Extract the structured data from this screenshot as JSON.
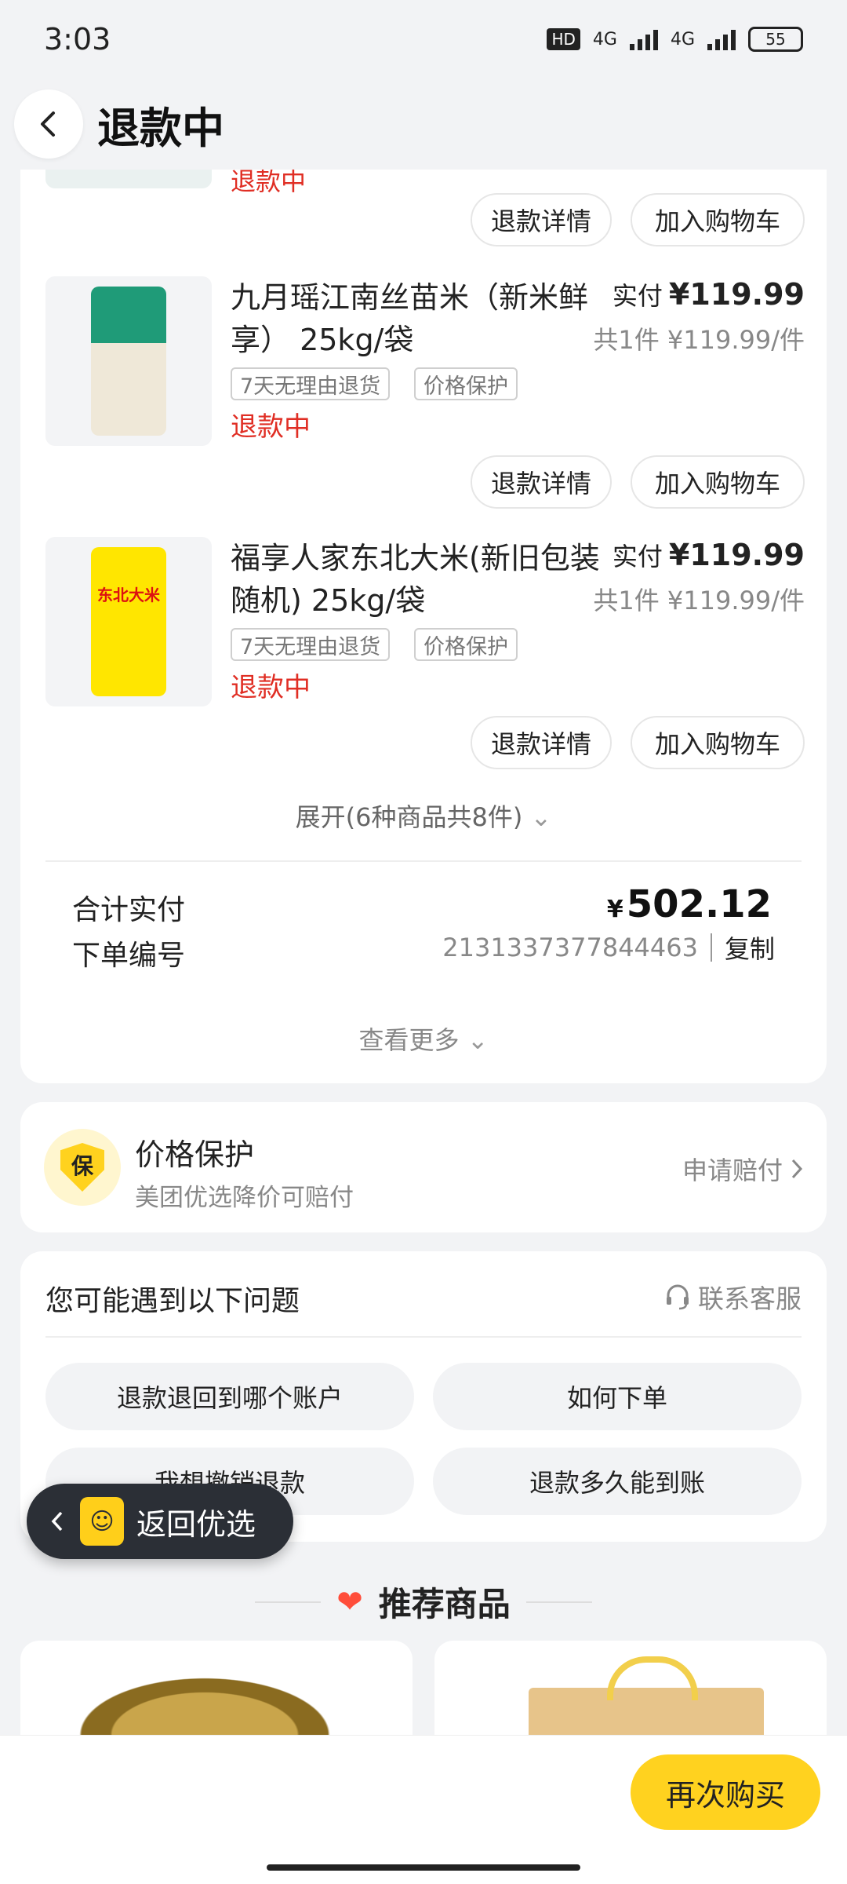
{
  "status_bar": {
    "time": "3:03",
    "hd_label": "HD",
    "network_1": "4G",
    "network_2": "4G",
    "battery": "55"
  },
  "header": {
    "back_icon": "chevron-left-icon",
    "title": "退款中"
  },
  "previous_item": {
    "actions": [
      "退款详情",
      "加入购物车"
    ]
  },
  "items": [
    {
      "title": "九月瑶江南丝苗米（新米鲜享） 25kg/袋",
      "tags": [
        "7天无理由退货",
        "价格保护"
      ],
      "status": "退款中",
      "paid_label": "实付",
      "paid_price": "¥119.99",
      "qty_price": "共1件 ¥119.99/件",
      "actions": [
        "退款详情",
        "加入购物车"
      ],
      "image_color": "#1f9b78"
    },
    {
      "title": "福享人家东北大米(新旧包装随机) 25kg/袋",
      "tags": [
        "7天无理由退货",
        "价格保护"
      ],
      "status": "退款中",
      "paid_label": "实付",
      "paid_price": "¥119.99",
      "qty_price": "共1件 ¥119.99/件",
      "actions": [
        "退款详情",
        "加入购物车"
      ],
      "image_color": "#ffe600",
      "image_text": "东北大米"
    }
  ],
  "order_summary": {
    "expand_label": "展开(6种商品共8件)",
    "total_label": "合计实付",
    "currency": "¥",
    "total_amount": "502.12",
    "order_no_label": "下单编号",
    "order_no": "2131337377844463",
    "copy_label": "复制",
    "see_more_label": "查看更多"
  },
  "price_protection": {
    "badge": "保",
    "title": "价格保护",
    "subtitle": "美团优选降价可赔付",
    "link": "申请赔付"
  },
  "faq": {
    "title": "您可能遇到以下问题",
    "service_label": "联系客服",
    "questions": [
      "退款退回到哪个账户",
      "如何下单",
      "我想撤销退款",
      "退款多久能到账"
    ]
  },
  "float_back": {
    "label": "返回优选"
  },
  "recommend": {
    "title": "推荐商品"
  },
  "bottom_bar": {
    "rebuy_label": "再次购买"
  },
  "colors": {
    "accent": "#ffd21f",
    "refund_red": "#e02e24",
    "page_bg": "#f2f3f5"
  }
}
